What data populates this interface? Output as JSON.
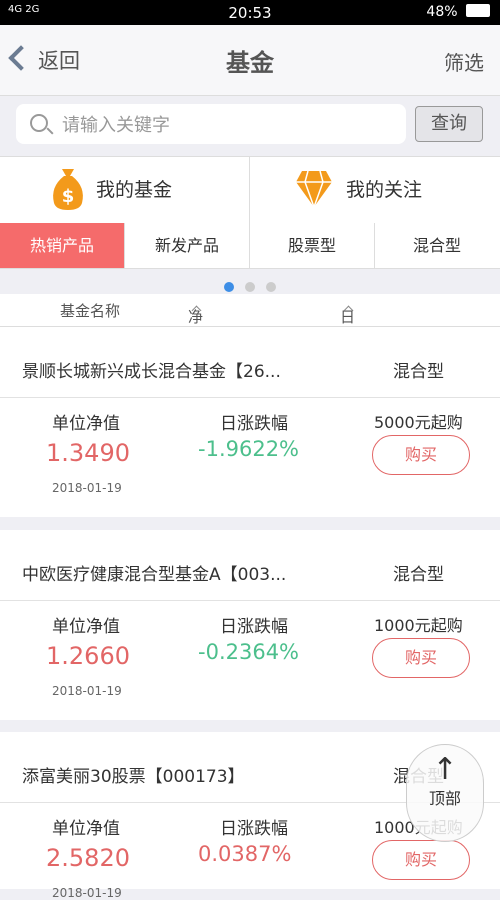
{
  "status_bar": {
    "left": "4G 2G",
    "time": "20:53",
    "battery": "48%"
  },
  "nav": {
    "back_label": "返回",
    "title": "基金",
    "filter_label": "筛选"
  },
  "search": {
    "placeholder": "请输入关键字",
    "button_label": "查询"
  },
  "quick_links": [
    {
      "label": "我的基金",
      "icon": "money-bag-icon"
    },
    {
      "label": "我的关注",
      "icon": "diamond-icon"
    }
  ],
  "tabs": [
    {
      "label": "热销产品",
      "active": true
    },
    {
      "label": "新发产品",
      "active": false
    },
    {
      "label": "股票型",
      "active": false
    },
    {
      "label": "混合型",
      "active": false
    }
  ],
  "pager": {
    "count": 3,
    "active_index": 0
  },
  "columns": {
    "name": "基金名称",
    "nav": "净值/万份收益",
    "change": "日涨跌/七日年化"
  },
  "funds": [
    {
      "name": "景顺长城新兴成长混合基金【26...",
      "type": "混合型",
      "nav_label": "单位净值",
      "nav": "1.3490",
      "date": "2018-01-19",
      "change_label": "日涨跌幅",
      "change": "-1.9622%",
      "change_color": "#4cbf8c",
      "min_buy": "5000元起购",
      "buy_label": "购买"
    },
    {
      "name": "中欧医疗健康混合型基金A【003...",
      "type": "混合型",
      "nav_label": "单位净值",
      "nav": "1.2660",
      "date": "2018-01-19",
      "change_label": "日涨跌幅",
      "change": "-0.2364%",
      "change_color": "#4cbf8c",
      "min_buy": "1000元起购",
      "buy_label": "购买"
    },
    {
      "name": "添富美丽30股票【000173】",
      "type": "混合型",
      "nav_label": "单位净值",
      "nav": "2.5820",
      "date": "2018-01-19",
      "change_label": "日涨跌幅",
      "change": "0.0387%",
      "change_color": "#e26666",
      "min_buy": "1000元起购",
      "buy_label": "购买"
    }
  ],
  "back_to_top": "顶部",
  "colors": {
    "accent_red": "#f56b6b",
    "down_green": "#4cbf8c",
    "up_red": "#e26666",
    "dot_blue": "#3d8ee6"
  }
}
